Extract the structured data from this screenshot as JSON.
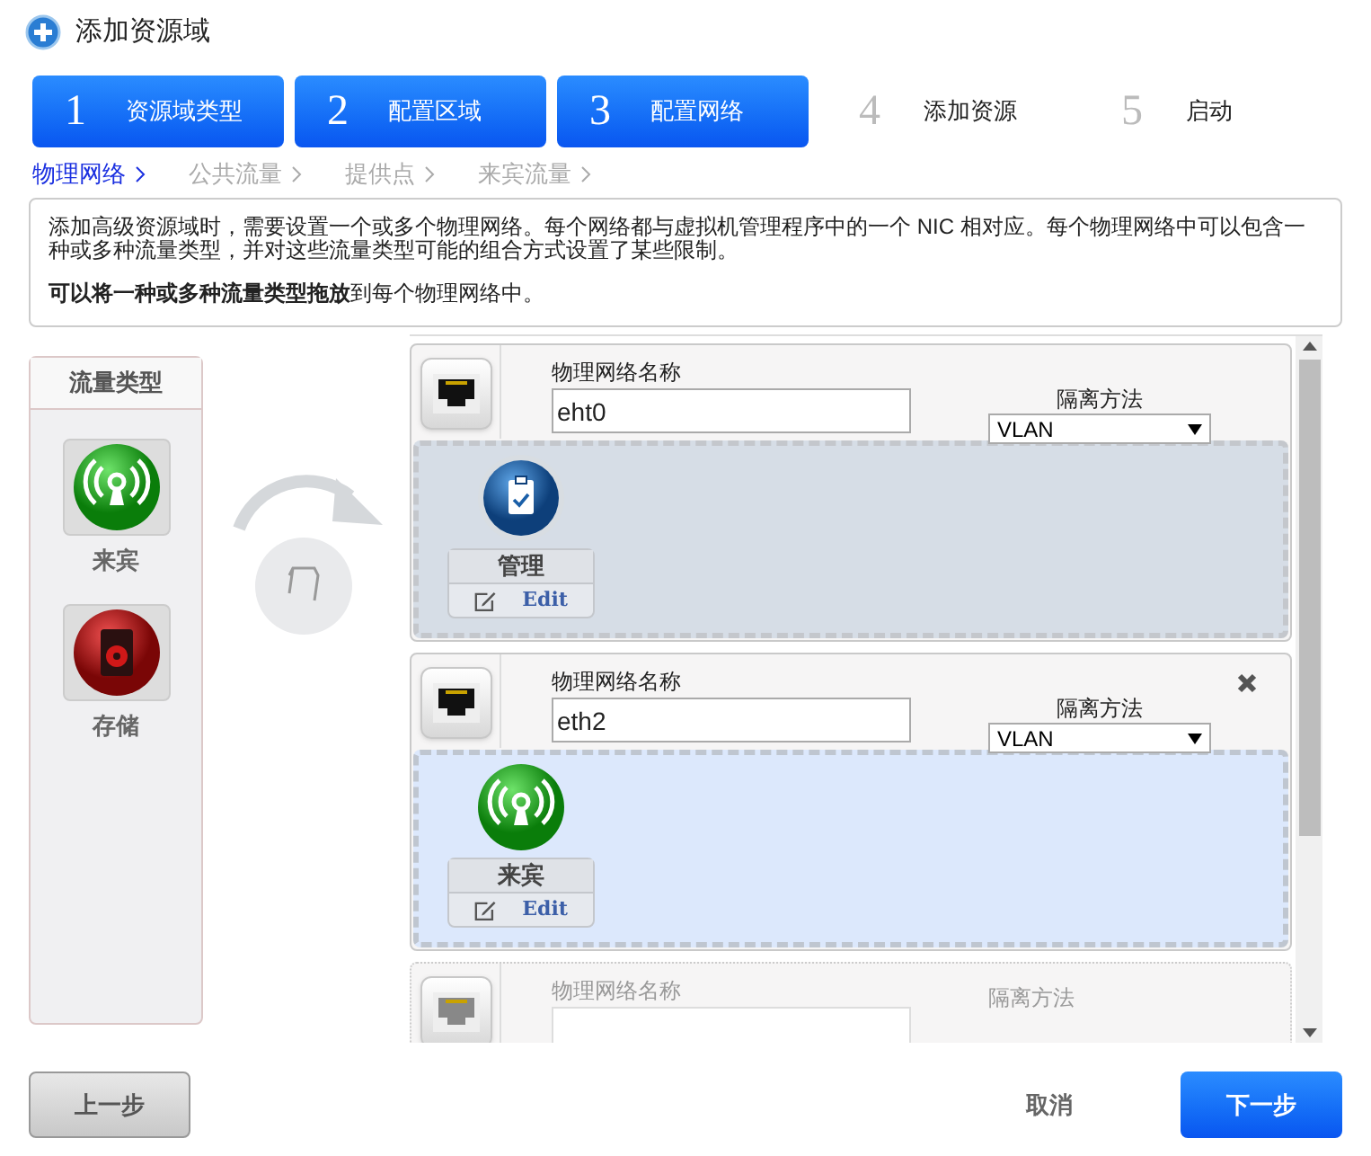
{
  "window": {
    "title": "添加资源域"
  },
  "steps": [
    {
      "number": "1",
      "label": "资源域类型",
      "selected": true
    },
    {
      "number": "2",
      "label": "配置区域",
      "selected": true
    },
    {
      "number": "3",
      "label": "配置网络",
      "selected": true
    },
    {
      "number": "4",
      "label": "添加资源",
      "selected": false
    },
    {
      "number": "5",
      "label": "启动",
      "selected": false
    }
  ],
  "substeps": [
    {
      "label": "物理网络",
      "selected": true
    },
    {
      "label": "公共流量",
      "selected": false
    },
    {
      "label": "提供点",
      "selected": false
    },
    {
      "label": "来宾流量",
      "selected": false
    }
  ],
  "description": {
    "text": "添加高级资源域时，需要设置一个或多个物理网络。每个网络都与虚拟机管理程序中的一个 NIC 相对应。每个物理网络中可以包含一种或多种流量类型，并对这些流量类型可能的组合方式设置了某些限制。",
    "note": "**可以将一种或多种流量类型拖放**到每个物理网络中。"
  },
  "traffic_types": {
    "title": "流量类型",
    "items": [
      {
        "label": "来宾",
        "kind": "guest"
      },
      {
        "label": "存储",
        "kind": "storage"
      }
    ]
  },
  "networks": [
    {
      "name_label": "物理网络名称",
      "name_value": "eht0",
      "isolation_label": "隔离方法",
      "isolation_value": "VLAN",
      "removable": false,
      "highlighted": false,
      "disabled": false,
      "traffic": [
        {
          "label": "管理",
          "kind": "management",
          "edit_label": "Edit"
        }
      ]
    },
    {
      "name_label": "物理网络名称",
      "name_value": "eth2",
      "isolation_label": "隔离方法",
      "isolation_value": "VLAN",
      "removable": true,
      "highlighted": true,
      "disabled": false,
      "traffic": [
        {
          "label": "来宾",
          "kind": "guest",
          "edit_label": "Edit"
        }
      ]
    },
    {
      "name_label": "物理网络名称",
      "isolation_label": "隔离方法",
      "removable": false,
      "disabled": true
    }
  ],
  "buttons": {
    "back": "上一步",
    "cancel": "取消",
    "next": "下一步"
  }
}
